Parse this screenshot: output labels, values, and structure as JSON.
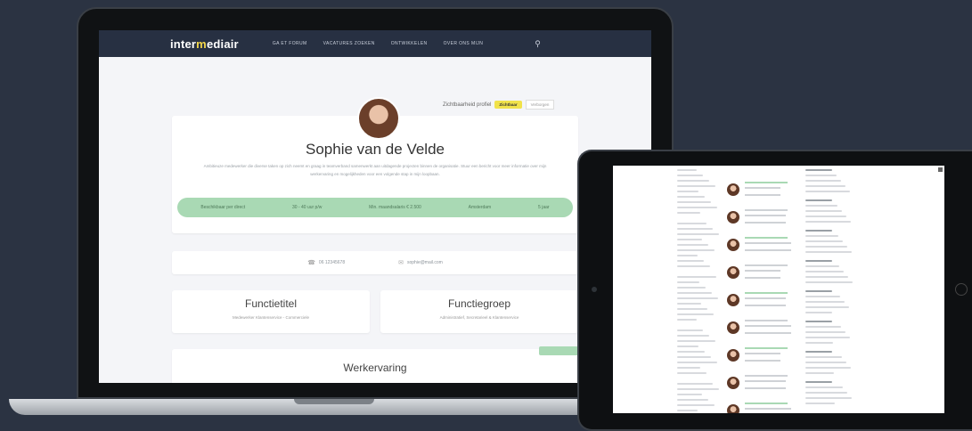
{
  "site": {
    "logo_pre": "inter",
    "logo_accent": "m",
    "logo_post": "ediair",
    "nav": [
      "Ga et forum",
      "Vacatures zoeken",
      "Ontwikkelen",
      "Over ons mijn"
    ]
  },
  "privacy": {
    "label": "Zichtbaarheid profiel",
    "on": "Zichtbaar",
    "off": "Verborgen"
  },
  "profile": {
    "name": "Sophie van de Velde",
    "bio": "Ambitieuze medewerker die diverse taken op zich neemt en graag in teamverband samenwerkt aan uitdagende projecten binnen de organisatie. Stuur een bericht voor meer informatie over mijn werkervaring en mogelijkheden voor een volgende stap in mijn loopbaan.",
    "tags": [
      "Beschikbaar per direct",
      "30 - 40 uur p/w",
      "Min. maandsalaris € 2.500",
      "Amsterdam",
      "5 jaar"
    ]
  },
  "contact": {
    "phone": "06 12345678",
    "email": "sophie@mail.com"
  },
  "functie": {
    "title_left": "Functietitel",
    "sub_left": "Medewerker Klantenservice - Commerciele",
    "title_right": "Functiegroep",
    "sub_right": "Administratief, Secretarieel & Klantenservice"
  },
  "work": {
    "title": "Werkervaring"
  },
  "colors": {
    "accent_green": "#a9d9b4",
    "accent_yellow": "#f1e24a",
    "nav_dark": "#273042",
    "background": "#2b3342"
  },
  "icons": {
    "search": "search-icon",
    "phone": "phone-icon",
    "mail": "mail-icon"
  }
}
